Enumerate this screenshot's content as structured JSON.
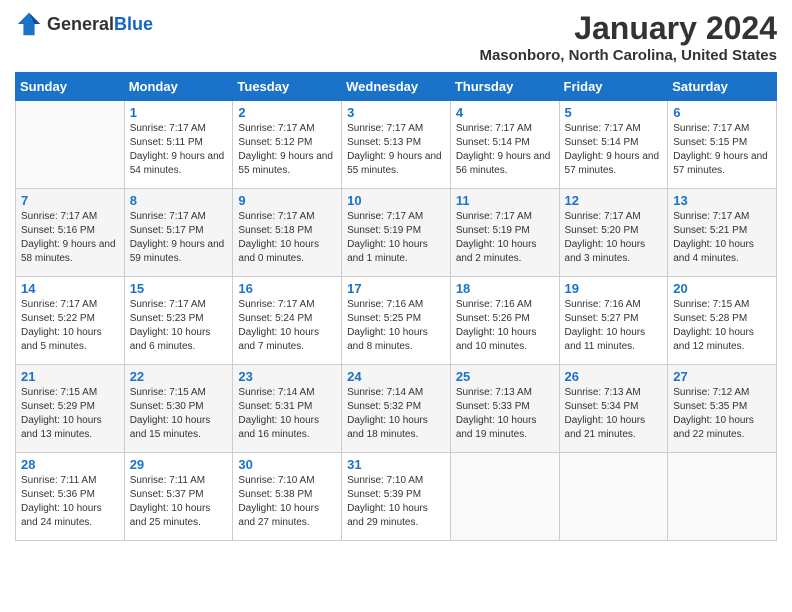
{
  "header": {
    "logo_general": "General",
    "logo_blue": "Blue",
    "month": "January 2024",
    "location": "Masonboro, North Carolina, United States"
  },
  "days_of_week": [
    "Sunday",
    "Monday",
    "Tuesday",
    "Wednesday",
    "Thursday",
    "Friday",
    "Saturday"
  ],
  "weeks": [
    [
      {
        "day": "",
        "sunrise": "",
        "sunset": "",
        "daylight": ""
      },
      {
        "day": "1",
        "sunrise": "Sunrise: 7:17 AM",
        "sunset": "Sunset: 5:11 PM",
        "daylight": "Daylight: 9 hours and 54 minutes."
      },
      {
        "day": "2",
        "sunrise": "Sunrise: 7:17 AM",
        "sunset": "Sunset: 5:12 PM",
        "daylight": "Daylight: 9 hours and 55 minutes."
      },
      {
        "day": "3",
        "sunrise": "Sunrise: 7:17 AM",
        "sunset": "Sunset: 5:13 PM",
        "daylight": "Daylight: 9 hours and 55 minutes."
      },
      {
        "day": "4",
        "sunrise": "Sunrise: 7:17 AM",
        "sunset": "Sunset: 5:14 PM",
        "daylight": "Daylight: 9 hours and 56 minutes."
      },
      {
        "day": "5",
        "sunrise": "Sunrise: 7:17 AM",
        "sunset": "Sunset: 5:14 PM",
        "daylight": "Daylight: 9 hours and 57 minutes."
      },
      {
        "day": "6",
        "sunrise": "Sunrise: 7:17 AM",
        "sunset": "Sunset: 5:15 PM",
        "daylight": "Daylight: 9 hours and 57 minutes."
      }
    ],
    [
      {
        "day": "7",
        "sunrise": "Sunrise: 7:17 AM",
        "sunset": "Sunset: 5:16 PM",
        "daylight": "Daylight: 9 hours and 58 minutes."
      },
      {
        "day": "8",
        "sunrise": "Sunrise: 7:17 AM",
        "sunset": "Sunset: 5:17 PM",
        "daylight": "Daylight: 9 hours and 59 minutes."
      },
      {
        "day": "9",
        "sunrise": "Sunrise: 7:17 AM",
        "sunset": "Sunset: 5:18 PM",
        "daylight": "Daylight: 10 hours and 0 minutes."
      },
      {
        "day": "10",
        "sunrise": "Sunrise: 7:17 AM",
        "sunset": "Sunset: 5:19 PM",
        "daylight": "Daylight: 10 hours and 1 minute."
      },
      {
        "day": "11",
        "sunrise": "Sunrise: 7:17 AM",
        "sunset": "Sunset: 5:19 PM",
        "daylight": "Daylight: 10 hours and 2 minutes."
      },
      {
        "day": "12",
        "sunrise": "Sunrise: 7:17 AM",
        "sunset": "Sunset: 5:20 PM",
        "daylight": "Daylight: 10 hours and 3 minutes."
      },
      {
        "day": "13",
        "sunrise": "Sunrise: 7:17 AM",
        "sunset": "Sunset: 5:21 PM",
        "daylight": "Daylight: 10 hours and 4 minutes."
      }
    ],
    [
      {
        "day": "14",
        "sunrise": "Sunrise: 7:17 AM",
        "sunset": "Sunset: 5:22 PM",
        "daylight": "Daylight: 10 hours and 5 minutes."
      },
      {
        "day": "15",
        "sunrise": "Sunrise: 7:17 AM",
        "sunset": "Sunset: 5:23 PM",
        "daylight": "Daylight: 10 hours and 6 minutes."
      },
      {
        "day": "16",
        "sunrise": "Sunrise: 7:17 AM",
        "sunset": "Sunset: 5:24 PM",
        "daylight": "Daylight: 10 hours and 7 minutes."
      },
      {
        "day": "17",
        "sunrise": "Sunrise: 7:16 AM",
        "sunset": "Sunset: 5:25 PM",
        "daylight": "Daylight: 10 hours and 8 minutes."
      },
      {
        "day": "18",
        "sunrise": "Sunrise: 7:16 AM",
        "sunset": "Sunset: 5:26 PM",
        "daylight": "Daylight: 10 hours and 10 minutes."
      },
      {
        "day": "19",
        "sunrise": "Sunrise: 7:16 AM",
        "sunset": "Sunset: 5:27 PM",
        "daylight": "Daylight: 10 hours and 11 minutes."
      },
      {
        "day": "20",
        "sunrise": "Sunrise: 7:15 AM",
        "sunset": "Sunset: 5:28 PM",
        "daylight": "Daylight: 10 hours and 12 minutes."
      }
    ],
    [
      {
        "day": "21",
        "sunrise": "Sunrise: 7:15 AM",
        "sunset": "Sunset: 5:29 PM",
        "daylight": "Daylight: 10 hours and 13 minutes."
      },
      {
        "day": "22",
        "sunrise": "Sunrise: 7:15 AM",
        "sunset": "Sunset: 5:30 PM",
        "daylight": "Daylight: 10 hours and 15 minutes."
      },
      {
        "day": "23",
        "sunrise": "Sunrise: 7:14 AM",
        "sunset": "Sunset: 5:31 PM",
        "daylight": "Daylight: 10 hours and 16 minutes."
      },
      {
        "day": "24",
        "sunrise": "Sunrise: 7:14 AM",
        "sunset": "Sunset: 5:32 PM",
        "daylight": "Daylight: 10 hours and 18 minutes."
      },
      {
        "day": "25",
        "sunrise": "Sunrise: 7:13 AM",
        "sunset": "Sunset: 5:33 PM",
        "daylight": "Daylight: 10 hours and 19 minutes."
      },
      {
        "day": "26",
        "sunrise": "Sunrise: 7:13 AM",
        "sunset": "Sunset: 5:34 PM",
        "daylight": "Daylight: 10 hours and 21 minutes."
      },
      {
        "day": "27",
        "sunrise": "Sunrise: 7:12 AM",
        "sunset": "Sunset: 5:35 PM",
        "daylight": "Daylight: 10 hours and 22 minutes."
      }
    ],
    [
      {
        "day": "28",
        "sunrise": "Sunrise: 7:11 AM",
        "sunset": "Sunset: 5:36 PM",
        "daylight": "Daylight: 10 hours and 24 minutes."
      },
      {
        "day": "29",
        "sunrise": "Sunrise: 7:11 AM",
        "sunset": "Sunset: 5:37 PM",
        "daylight": "Daylight: 10 hours and 25 minutes."
      },
      {
        "day": "30",
        "sunrise": "Sunrise: 7:10 AM",
        "sunset": "Sunset: 5:38 PM",
        "daylight": "Daylight: 10 hours and 27 minutes."
      },
      {
        "day": "31",
        "sunrise": "Sunrise: 7:10 AM",
        "sunset": "Sunset: 5:39 PM",
        "daylight": "Daylight: 10 hours and 29 minutes."
      },
      {
        "day": "",
        "sunrise": "",
        "sunset": "",
        "daylight": ""
      },
      {
        "day": "",
        "sunrise": "",
        "sunset": "",
        "daylight": ""
      },
      {
        "day": "",
        "sunrise": "",
        "sunset": "",
        "daylight": ""
      }
    ]
  ]
}
